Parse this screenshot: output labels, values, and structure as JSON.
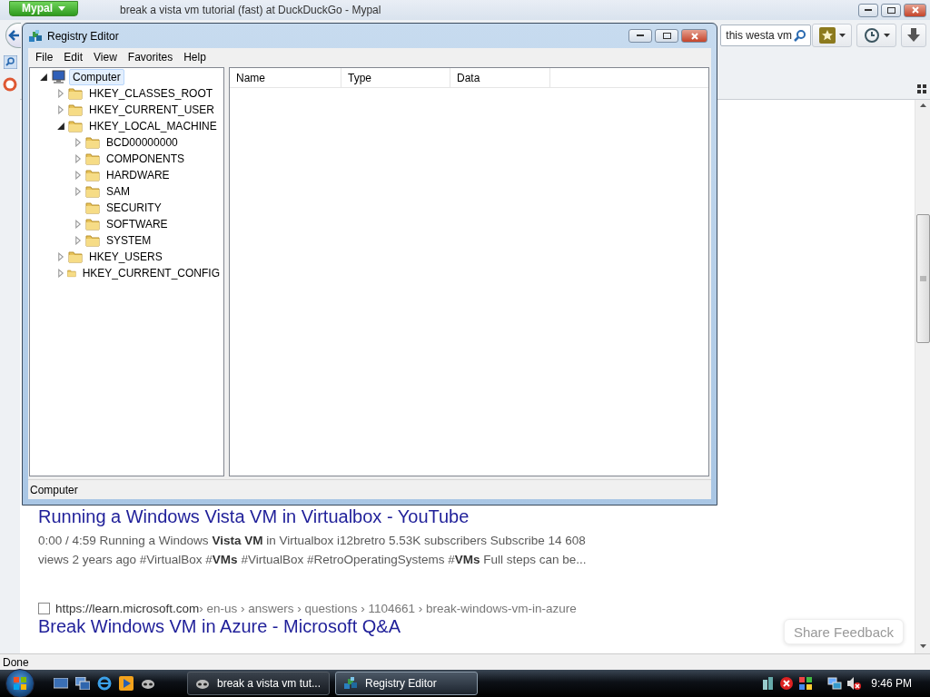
{
  "browser": {
    "menu_button": "Mypal",
    "title": "break a vista vm tutorial (fast) at DuckDuckGo - Mypal",
    "search": {
      "value": "this westa vm"
    },
    "results": [
      {
        "title": "Running a Windows Vista VM in Virtualbox - YouTube",
        "snippet": "0:00 / 4:59 Running a Windows **Vista VM** in Virtualbox i12bretro 5.53K subscribers Subscribe 14 608 views 2 years ago #VirtualBox #**VMs** #VirtualBox #RetroOperatingSystems #**VMs** Full steps can be..."
      },
      {
        "site": "https://learn.microsoft.com",
        "path": " › en-us › answers › questions › 1104661 › break-windows-vm-in-azure",
        "title": "Break Windows VM in Azure - Microsoft Q&A"
      }
    ],
    "feedback_button": "Share Feedback",
    "status": "Done"
  },
  "registry_editor": {
    "title": "Registry Editor",
    "menu": [
      "File",
      "Edit",
      "View",
      "Favorites",
      "Help"
    ],
    "tree": [
      {
        "label": "Computer",
        "selected": true,
        "expanded": true,
        "children": [
          {
            "label": "HKEY_CLASSES_ROOT",
            "selected": false,
            "expanded": false
          },
          {
            "label": "HKEY_CURRENT_USER",
            "selected": false,
            "expanded": false
          },
          {
            "label": "HKEY_LOCAL_MACHINE",
            "selected": false,
            "expanded": true,
            "children": [
              {
                "label": "BCD00000000",
                "selected": false,
                "expanded": false
              },
              {
                "label": "COMPONENTS",
                "selected": false,
                "expanded": false
              },
              {
                "label": "HARDWARE",
                "selected": false,
                "expanded": false
              },
              {
                "label": "SAM",
                "selected": false,
                "expanded": false
              },
              {
                "label": "SECURITY",
                "selected": false
              },
              {
                "label": "SOFTWARE",
                "selected": false,
                "expanded": false
              },
              {
                "label": "SYSTEM",
                "selected": false,
                "expanded": false
              }
            ]
          },
          {
            "label": "HKEY_USERS",
            "selected": false,
            "expanded": false
          },
          {
            "label": "HKEY_CURRENT_CONFIG",
            "selected": false,
            "expanded": false
          }
        ]
      }
    ],
    "columns": [
      "Name",
      "Type",
      "Data"
    ],
    "status": "Computer"
  },
  "taskbar": {
    "tasks": [
      {
        "label": "break a vista vm tut...",
        "selected": false,
        "kind": "browser"
      },
      {
        "label": "Registry Editor",
        "selected": true,
        "kind": "registry"
      }
    ],
    "clock": "9:46 PM"
  }
}
